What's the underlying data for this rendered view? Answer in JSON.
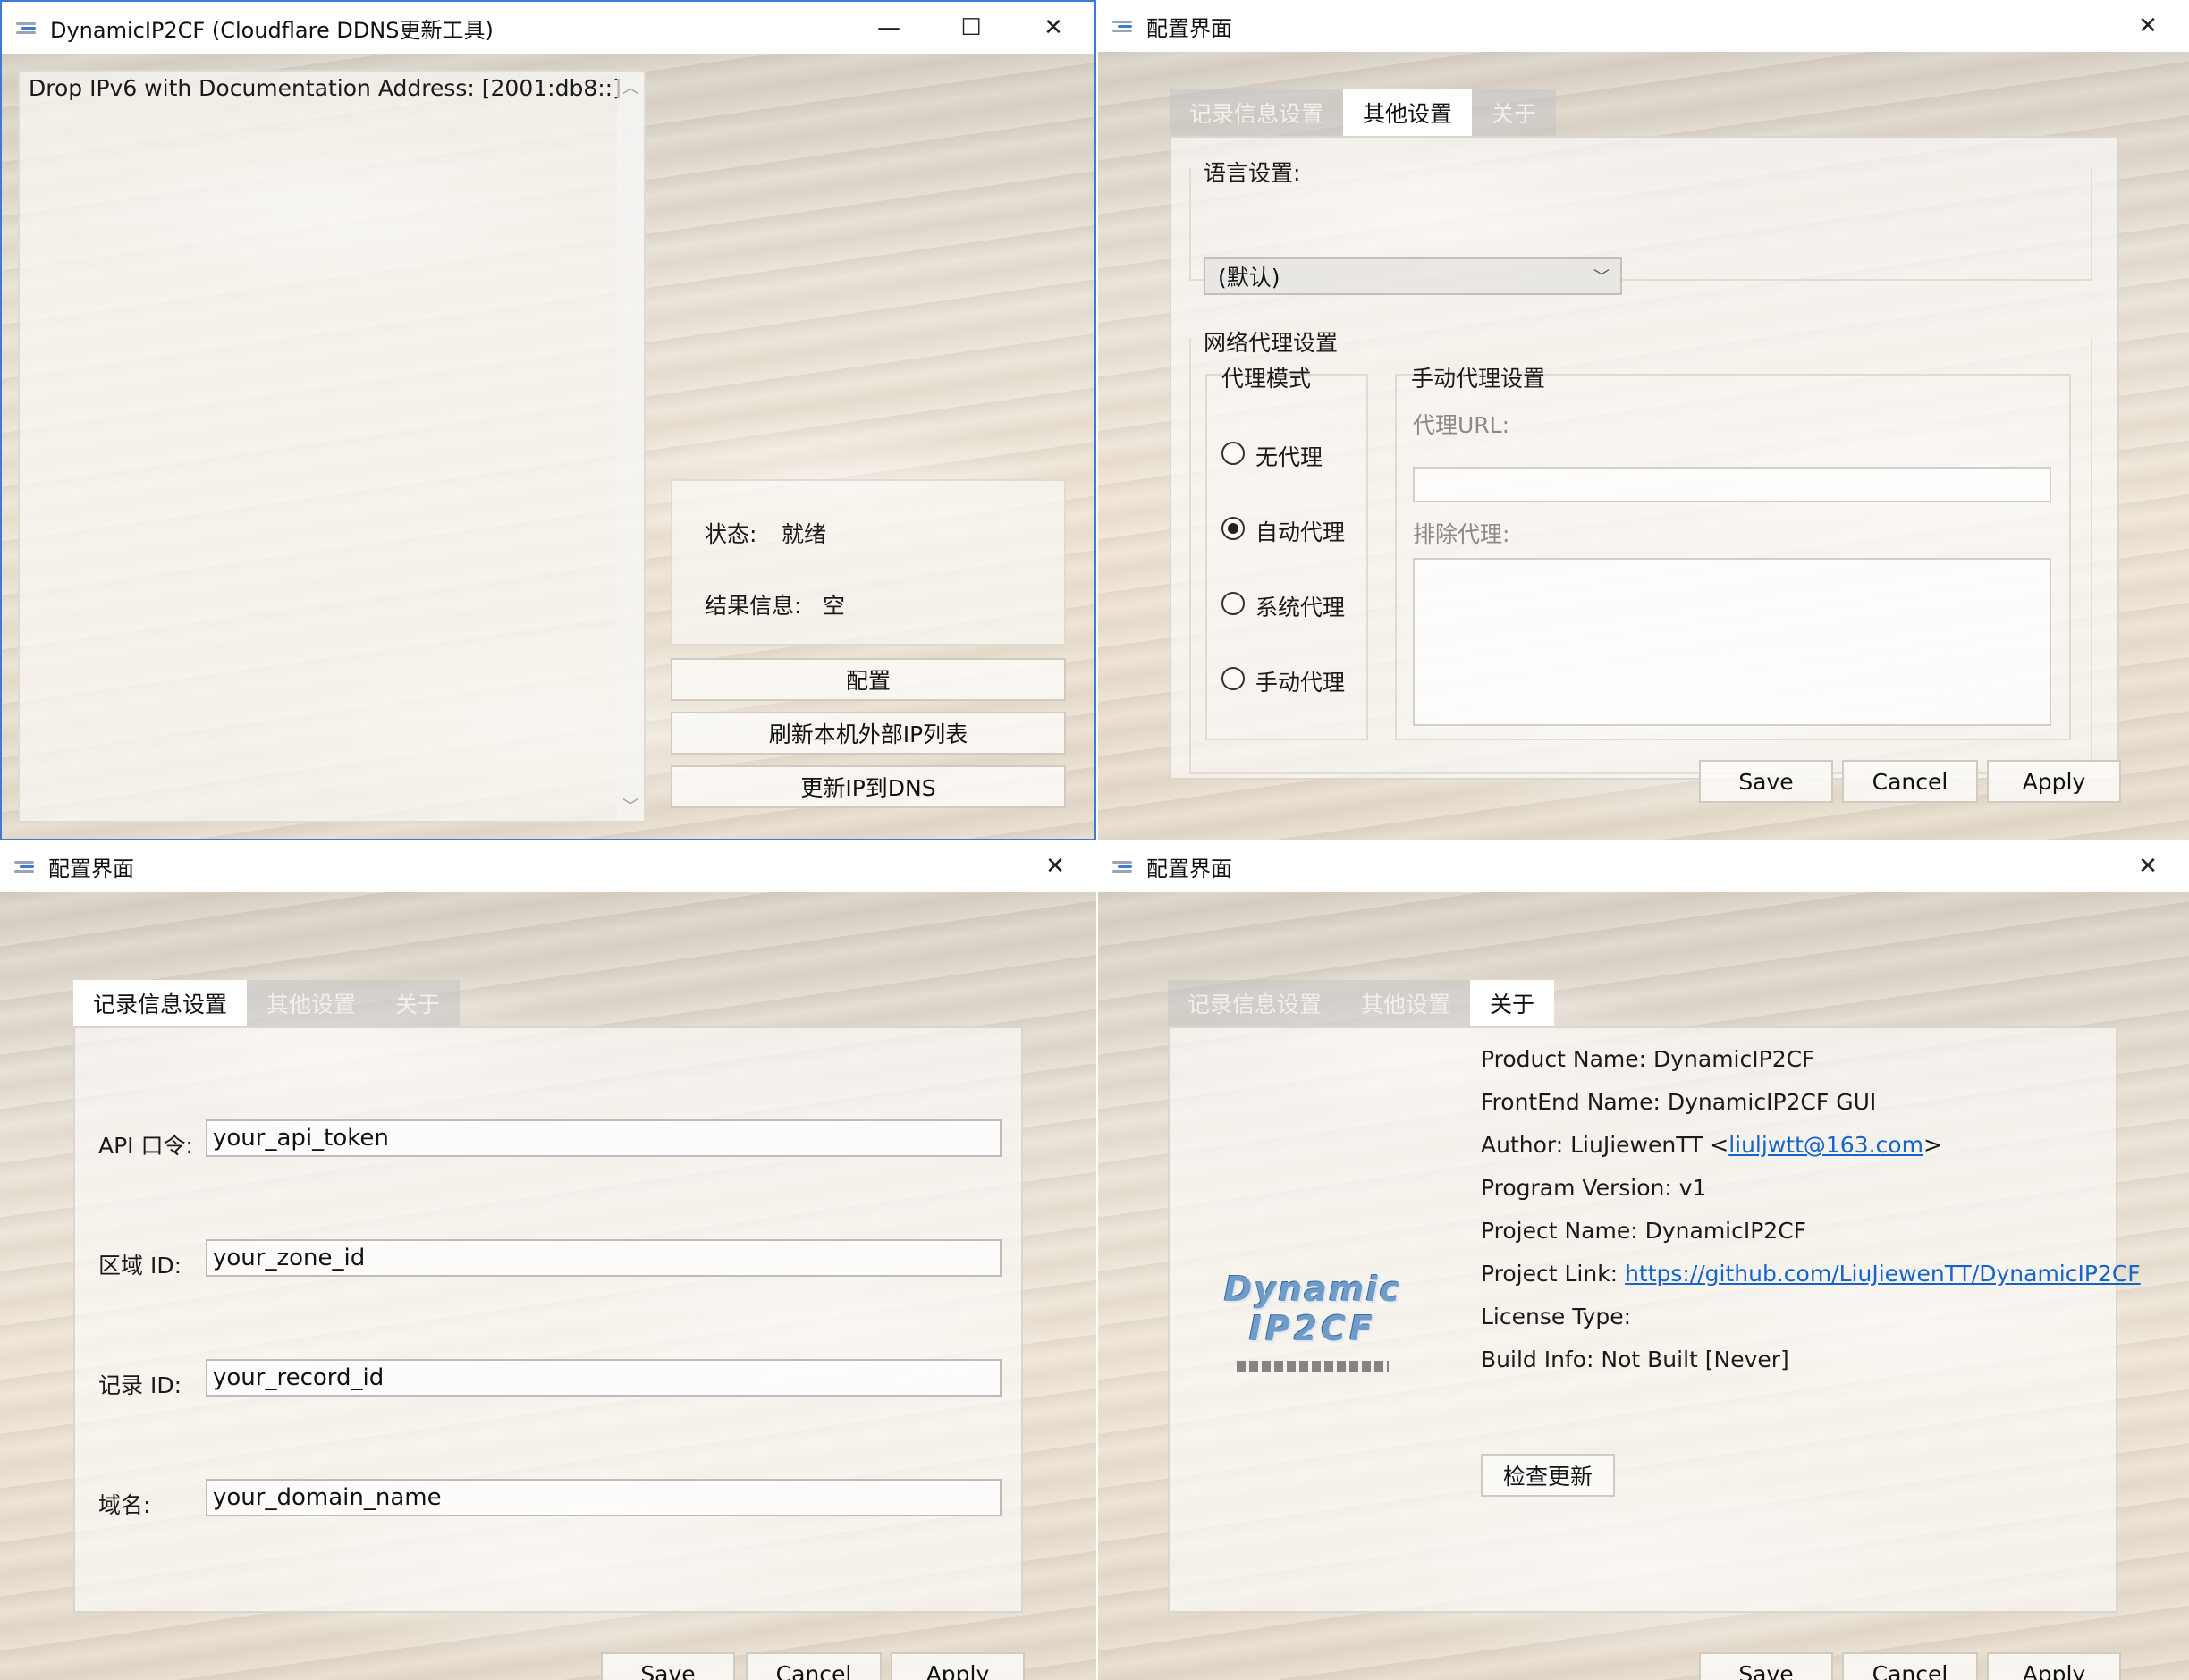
{
  "main_window": {
    "title": "DynamicIP2CF (Cloudflare DDNS更新工具)",
    "log_text": "Drop IPv6 with Documentation Address: [2001:db8::]",
    "status_label": "状态:",
    "status_value": "就绪",
    "result_label": "结果信息:",
    "result_value": "空",
    "config_button": "配置",
    "refresh_button": "刷新本机外部IP列表",
    "update_button": "更新IP到DNS",
    "minimize": "—",
    "maximize": "☐",
    "close": "✕"
  },
  "config_title": "配置界面",
  "close_glyph": "✕",
  "tabs": [
    "记录信息设置",
    "其他设置",
    "关于"
  ],
  "dialog_buttons": {
    "save": "Save",
    "cancel": "Cancel",
    "apply": "Apply"
  },
  "other_settings": {
    "language_label": "语言设置:",
    "language_value": "(默认)",
    "proxy_group": "网络代理设置",
    "proxy_mode_label": "代理模式",
    "modes": [
      "无代理",
      "自动代理",
      "系统代理",
      "手动代理"
    ],
    "selected_mode": "自动代理",
    "manual_group": "手动代理设置",
    "proxy_url_label": "代理URL:",
    "proxy_url_value": "",
    "exclude_label": "排除代理:",
    "exclude_value": ""
  },
  "record_settings": {
    "api_label": "API 口令:",
    "api_value": "your_api_token",
    "zone_label": "区域 ID:",
    "zone_value": "your_zone_id",
    "record_label": "记录 ID:",
    "record_value": "your_record_id",
    "domain_label": "域名:",
    "domain_value": "your_domain_name"
  },
  "about": {
    "logo_line1": "Dynamic",
    "logo_line2": "IP2CF",
    "product": "Product Name: DynamicIP2CF",
    "frontend": "FrontEnd Name: DynamicIP2CF GUI",
    "author_prefix": "Author: LiuJiewenTT <",
    "author_email": "liuljwtt@163.com",
    "author_suffix": ">",
    "version": "Program Version: v1",
    "project": "Project Name: DynamicIP2CF",
    "link_prefix": "Project Link: ",
    "link_url": "https://github.com/LiuJiewenTT/DynamicIP2CF",
    "license": "License Type:",
    "build": "Build Info: Not Built [Never]",
    "check_update": "检查更新"
  },
  "colors": {
    "accent": "#1664c8",
    "icon_blue": "#3b7bd6",
    "icon_grey": "#9aa4b2"
  }
}
